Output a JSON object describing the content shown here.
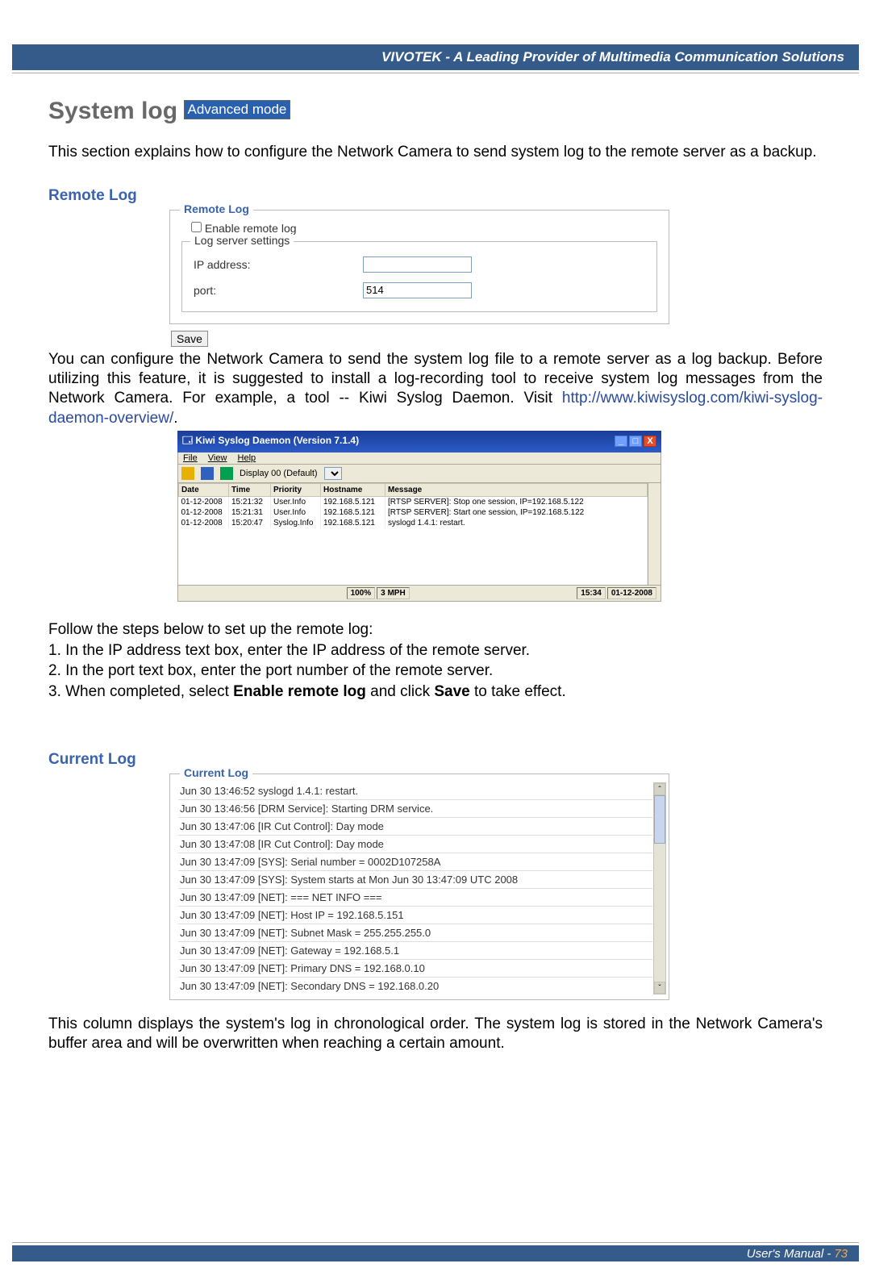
{
  "header": {
    "brand_tagline": "VIVOTEK - A Leading Provider of Multimedia Communication Solutions"
  },
  "title": {
    "main": "System log",
    "badge": "Advanced mode"
  },
  "intro": "This section explains how to configure the Network Camera to send system log to the remote server as a backup.",
  "remote_log": {
    "heading": "Remote Log",
    "fieldset_legend": "Remote Log",
    "enable_label": "Enable remote log",
    "server_legend": "Log server settings",
    "ip_label": "IP address:",
    "ip_value": "",
    "port_label": "port:",
    "port_value": "514",
    "save_label": "Save"
  },
  "explain": {
    "text_pre": "You can configure the Network Camera to send the system log file to a remote server as a log backup. Before utilizing this feature, it is suggested to install a log-recording tool to receive system log messages from the Network Camera. For example, a tool -- Kiwi Syslog Daemon. Visit ",
    "link": "http://www.kiwisyslog.com/kiwi-syslog-daemon-overview/",
    "period": "."
  },
  "kiwi": {
    "title": "Kiwi Syslog Daemon (Version 7.1.4)",
    "menus": {
      "file": "File",
      "view": "View",
      "help": "Help"
    },
    "display_label": "Display 00 (Default)",
    "columns": {
      "date": "Date",
      "time": "Time",
      "priority": "Priority",
      "hostname": "Hostname",
      "message": "Message"
    },
    "rows": [
      {
        "date": "01-12-2008",
        "time": "15:21:32",
        "priority": "User.Info",
        "hostname": "192.168.5.121",
        "message": "[RTSP SERVER]: Stop one session, IP=192.168.5.122"
      },
      {
        "date": "01-12-2008",
        "time": "15:21:31",
        "priority": "User.Info",
        "hostname": "192.168.5.121",
        "message": "[RTSP SERVER]: Start one session, IP=192.168.5.122"
      },
      {
        "date": "01-12-2008",
        "time": "15:20:47",
        "priority": "Syslog.Info",
        "hostname": "192.168.5.121",
        "message": "syslogd 1.4.1: restart."
      }
    ],
    "status": {
      "pct": "100%",
      "mph": "3 MPH",
      "time": "15:34",
      "date": "01-12-2008"
    }
  },
  "steps": {
    "lead": "Follow the steps below to set up the remote log:",
    "s1": "1. In the IP address text box, enter the IP address of the remote server.",
    "s2": "2. In the port text box, enter the port number of the remote server.",
    "s3a": "3. When completed, select ",
    "s3b": "Enable remote log",
    "s3c": " and click ",
    "s3d": "Save",
    "s3e": " to take effect."
  },
  "current_log": {
    "heading": "Current Log",
    "legend": "Current Log",
    "lines": [
      "Jun 30 13:46:52 syslogd 1.4.1: restart.",
      "Jun 30 13:46:56 [DRM Service]: Starting DRM service.",
      "Jun 30 13:47:06 [IR Cut Control]: Day mode",
      "Jun 30 13:47:08 [IR Cut Control]: Day mode",
      "Jun 30 13:47:09 [SYS]: Serial number = 0002D107258A",
      "Jun 30 13:47:09 [SYS]: System starts at Mon Jun 30 13:47:09 UTC 2008",
      "Jun 30 13:47:09 [NET]: === NET INFO ===",
      "Jun 30 13:47:09 [NET]: Host IP = 192.168.5.151",
      "Jun 30 13:47:09 [NET]: Subnet Mask = 255.255.255.0",
      "Jun 30 13:47:09 [NET]: Gateway = 192.168.5.1",
      "Jun 30 13:47:09 [NET]: Primary DNS = 192.168.0.10",
      "Jun 30 13:47:09 [NET]: Secondary DNS = 192.168.0.20"
    ],
    "after": "This column displays the system's log in chronological order. The system log is stored in the Network Camera's buffer area and will be overwritten when reaching a certain amount."
  },
  "footer": {
    "manual": "User's Manual - ",
    "page": "73"
  }
}
